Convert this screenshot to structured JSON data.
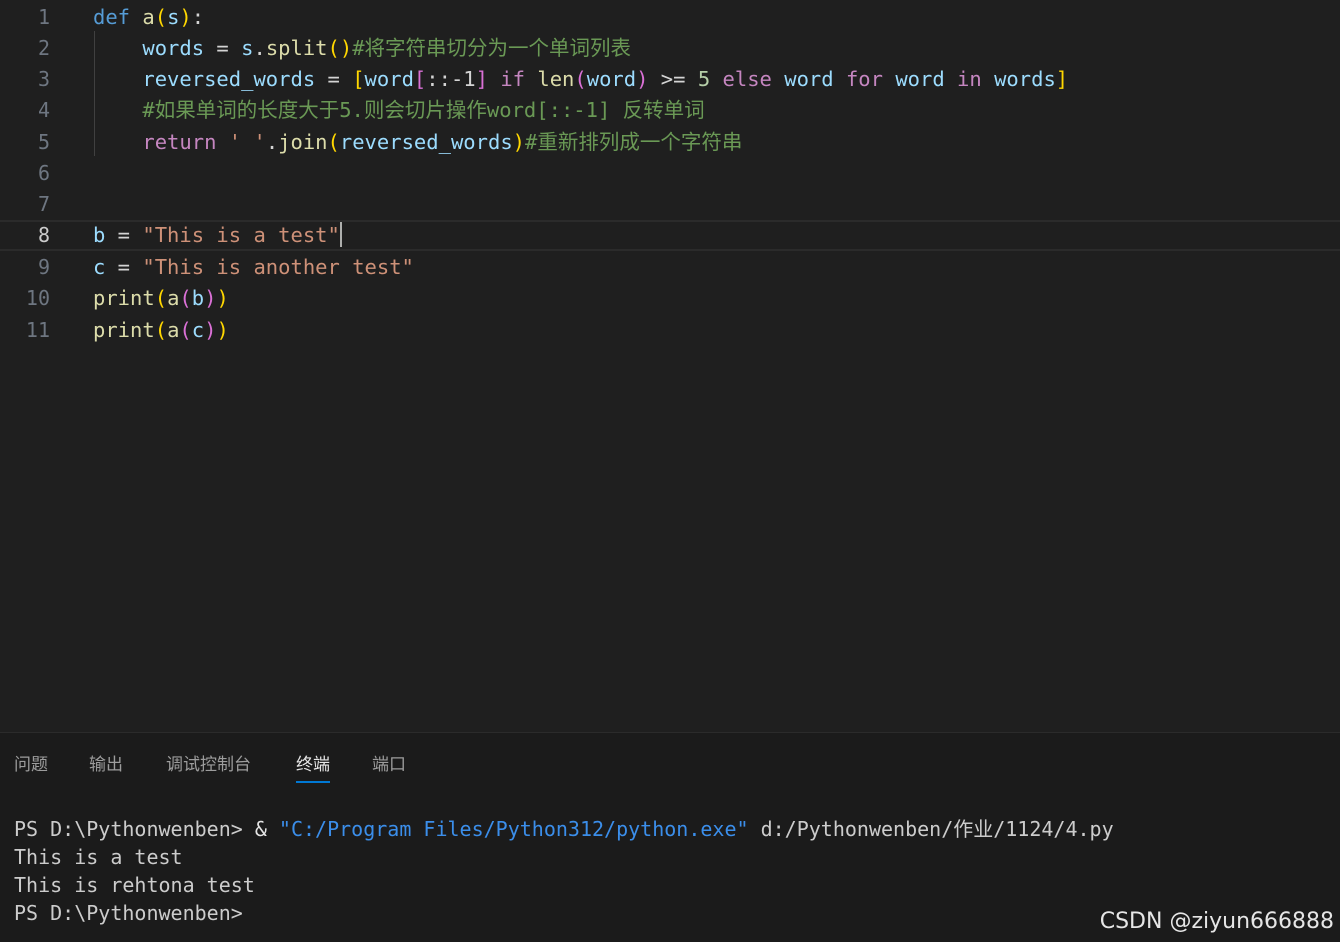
{
  "editor": {
    "line_numbers": [
      "1",
      "2",
      "3",
      "4",
      "5",
      "6",
      "7",
      "8",
      "9",
      "10",
      "11"
    ],
    "current_line": "8",
    "line1": {
      "def": "def",
      "name": "a",
      "open": "(",
      "param": "s",
      "close": ")",
      "colon": ":"
    },
    "line2": {
      "indent": "    ",
      "var": "words",
      "eq": " = ",
      "obj": "s",
      "dot": ".",
      "method": "split",
      "parens": "()",
      "comment": "#将字符串切分为一个单词列表"
    },
    "line3": {
      "indent": "    ",
      "var": "reversed_words",
      "eq": " = ",
      "lb": "[",
      "word1": "word",
      "slice_open": "[",
      "slice": "::-1",
      "slice_close": "]",
      "if_kw": " if ",
      "len_fn": "len",
      "lp": "(",
      "word2": "word",
      "rp": ")",
      "ge": " >= ",
      "five": "5",
      "else_kw": " else ",
      "word3": "word",
      "for_kw": " for ",
      "word4": "word",
      "in_kw": " in ",
      "words": "words",
      "rb": "]"
    },
    "line4": {
      "indent": "    ",
      "comment": "#如果单词的长度大于5.则会切片操作word[::-1] 反转单词"
    },
    "line5": {
      "indent": "    ",
      "return_kw": "return",
      "sp": " ",
      "str": "' '",
      "dot": ".",
      "join": "join",
      "lp": "(",
      "arg": "reversed_words",
      "rp": ")",
      "comment": "#重新排列成一个字符串"
    },
    "line8": {
      "var": "b",
      "eq": " = ",
      "str": "\"This is a test\""
    },
    "line9": {
      "var": "c",
      "eq": " = ",
      "str": "\"This is another test\""
    },
    "line10": {
      "fn": "print",
      "lp": "(",
      "call": "a",
      "lp2": "(",
      "arg": "b",
      "rp2": ")",
      "rp": ")"
    },
    "line11": {
      "fn": "print",
      "lp": "(",
      "call": "a",
      "lp2": "(",
      "arg": "c",
      "rp2": ")",
      "rp": ")"
    }
  },
  "panel": {
    "tabs": [
      "问题",
      "输出",
      "调试控制台",
      "终端",
      "端口"
    ],
    "active_tab": "终端",
    "terminal": {
      "line1_prompt": "PS D:\\Pythonwenben> ",
      "line1_amp": "& ",
      "line1_path": "\"C:/Program Files/Python312/python.exe\"",
      "line1_script": " d:/Pythonwenben/作业/1124/4.py",
      "line2": "This is a test",
      "line3": "This is rehtona test",
      "line4": "PS D:\\Pythonwenben>"
    }
  },
  "watermark": "CSDN @ziyun666888",
  "colors": {
    "background": "#1f1f1f",
    "keyword": "#569cd6",
    "control_keyword": "#c586c0",
    "function": "#dcdcaa",
    "variable": "#9cdcfe",
    "string": "#ce9178",
    "comment": "#6a9955",
    "active_tab_underline": "#0078d4"
  }
}
